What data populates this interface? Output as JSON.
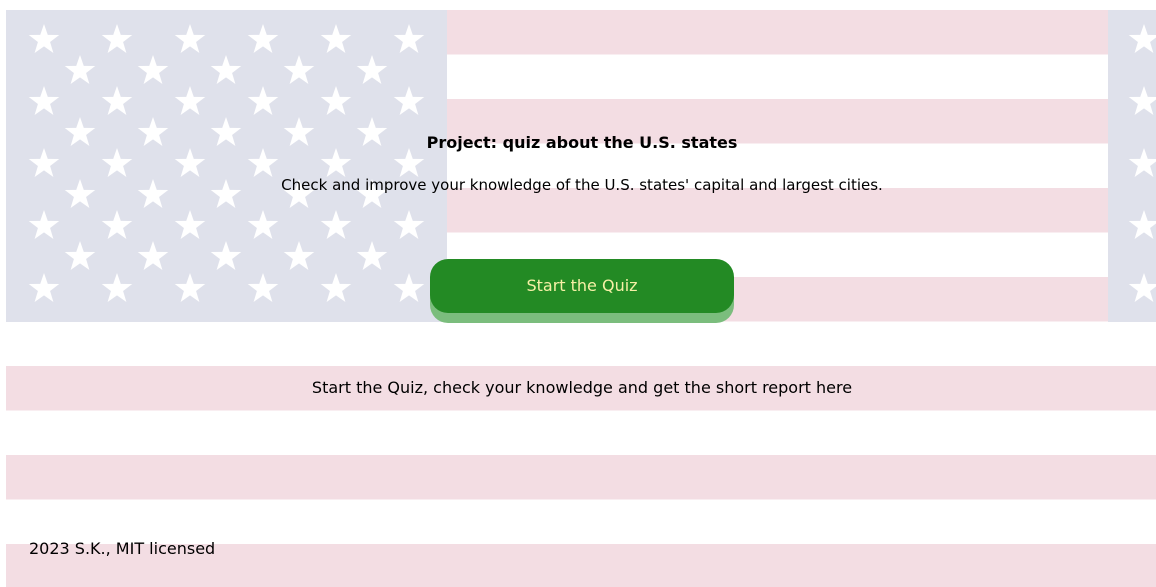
{
  "hero": {
    "title": "Project: quiz about the U.S. states",
    "subtitle": "Check and improve your knowledge of the U.S. states' capital and largest cities.",
    "start_button_label": "Start the Quiz"
  },
  "info": {
    "text": "Start the Quiz, check your knowledge and get the short report here"
  },
  "footer": {
    "text": "2023 S.K., MIT licensed"
  },
  "colors": {
    "stripe_red": "#f3dde3",
    "stripe_white": "#ffffff",
    "canton_blue": "#dfe1eb",
    "button_green": "#238a24",
    "button_text": "#f6f0a6",
    "button_shadow": "#7bbd7d"
  },
  "icons": {
    "background": "us-flag-background",
    "stars": "star-icon"
  }
}
